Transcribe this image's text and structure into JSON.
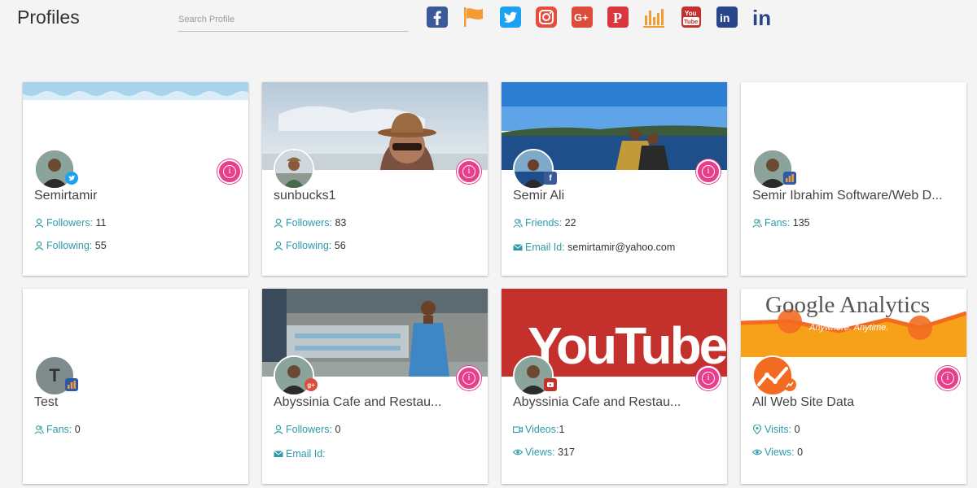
{
  "header": {
    "title": "Profiles",
    "search_placeholder": "Search Profile"
  },
  "social_icons": [
    {
      "name": "facebook-icon",
      "color": "#3b5998"
    },
    {
      "name": "flag-icon",
      "color": "#f39c33"
    },
    {
      "name": "twitter-icon",
      "color": "#1da1f2"
    },
    {
      "name": "instagram-icon",
      "color": "#e74c3c"
    },
    {
      "name": "google-plus-icon",
      "color": "#dd4b39"
    },
    {
      "name": "pinterest-icon",
      "color": "#d9363e"
    },
    {
      "name": "analytics-icon",
      "color": "#f39c33"
    },
    {
      "name": "youtube-icon",
      "color": "#c4302b"
    },
    {
      "name": "linkedin-box-icon",
      "color": "#28458c"
    },
    {
      "name": "linkedin-icon",
      "color": "#28458c"
    }
  ],
  "cards": [
    {
      "name": "Semirtamir",
      "network": "twitter",
      "stats": [
        {
          "icon": "user-icon",
          "label": "Followers:",
          "value": "11"
        },
        {
          "icon": "user-icon",
          "label": "Following:",
          "value": "55"
        }
      ]
    },
    {
      "name": "sunbucks1",
      "network": "instagram",
      "stats": [
        {
          "icon": "user-icon",
          "label": "Followers:",
          "value": "83"
        },
        {
          "icon": "user-icon",
          "label": "Following:",
          "value": "56"
        }
      ]
    },
    {
      "name": "Semir Ali",
      "network": "facebook",
      "stats": [
        {
          "icon": "users-icon",
          "label": "Friends:",
          "value": "22"
        },
        {
          "icon": "mail-icon",
          "label": "Email Id:",
          "value": "semirtamir@yahoo.com"
        }
      ]
    },
    {
      "name": "Semir Ibrahim Software/Web D...",
      "network": "page",
      "stats": [
        {
          "icon": "users-icon",
          "label": "Fans:",
          "value": "135"
        }
      ]
    },
    {
      "name": "Test",
      "network": "page",
      "avatar_letter": "T",
      "stats": [
        {
          "icon": "users-icon",
          "label": "Fans:",
          "value": "0"
        }
      ]
    },
    {
      "name": "Abyssinia Cafe and Restau...",
      "network": "google-plus",
      "stats": [
        {
          "icon": "user-icon",
          "label": "Followers:",
          "value": "0"
        },
        {
          "icon": "mail-icon",
          "label": "Email Id:",
          "value": ""
        }
      ]
    },
    {
      "name": "Abyssinia Cafe and Restau...",
      "network": "youtube",
      "banner_text": "YouTube",
      "stats": [
        {
          "icon": "video-icon",
          "label": "Videos:",
          "value": "1"
        },
        {
          "icon": "eye-icon",
          "label": "Views:",
          "value": "317"
        }
      ]
    },
    {
      "name": "All Web Site Data",
      "network": "analytics",
      "banner_title": "Google Analytics",
      "banner_sub": "Anywhere. Anytime.",
      "stats": [
        {
          "icon": "pin-icon",
          "label": "Visits:",
          "value": "0"
        },
        {
          "icon": "eye-icon",
          "label": "Views:",
          "value": "0"
        }
      ]
    }
  ]
}
